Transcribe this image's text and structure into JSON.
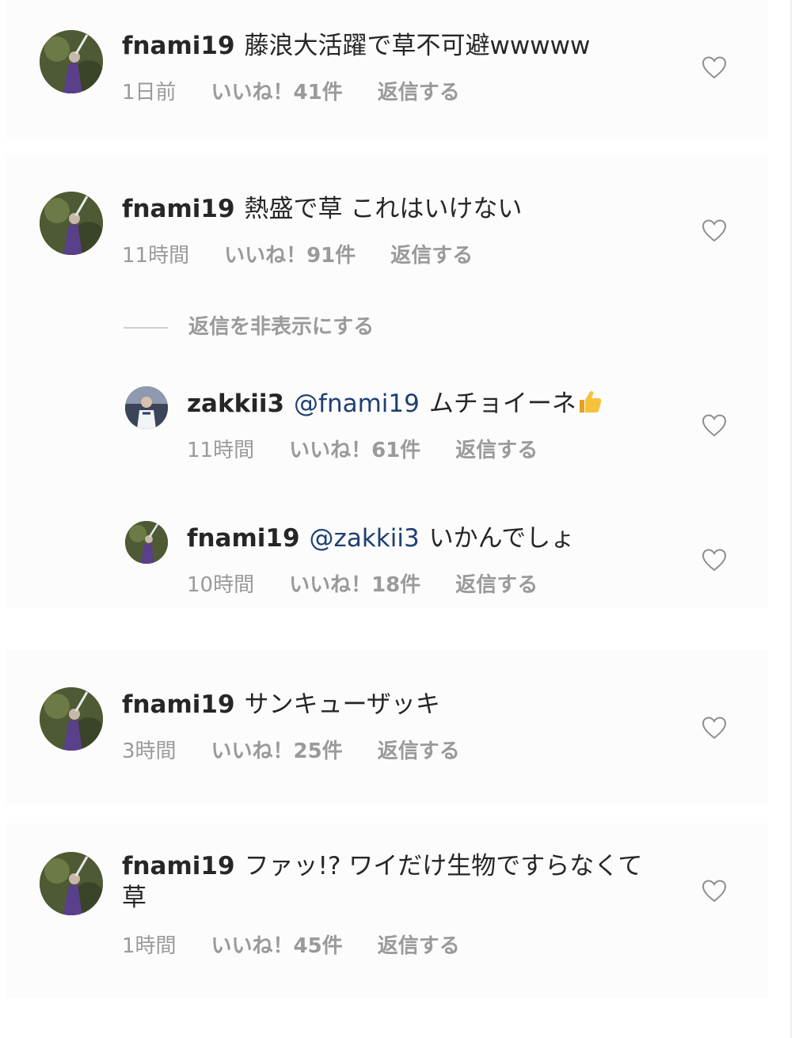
{
  "comments": [
    {
      "username": "fnami19",
      "text": "藤浪大活躍で草不可避wwwww",
      "time": "1日前",
      "likes": "いいね！41件",
      "reply": "返信する"
    },
    {
      "username": "fnami19",
      "text": "熱盛で草  これはいけない",
      "time": "11時間",
      "likes": "いいね！91件",
      "reply": "返信する"
    },
    {
      "username": "fnami19",
      "text": "サンキューザッキ",
      "time": "3時間",
      "likes": "いいね！25件",
      "reply": "返信する"
    },
    {
      "username": "fnami19",
      "text": "ファッ!? ワイだけ生物ですらなくて草",
      "time": "1時間",
      "likes": "いいね！45件",
      "reply": "返信する"
    }
  ],
  "hide_replies": "返信を非表示にする",
  "replies": [
    {
      "username": "zakkii3",
      "mention": "@fnami19",
      "text": "ムチョイーネ",
      "time": "11時間",
      "likes": "いいね！61件",
      "reply": "返信する"
    },
    {
      "username": "fnami19",
      "mention": "@zakkii3",
      "text": "いかんでしょ",
      "time": "10時間",
      "likes": "いいね！18件",
      "reply": "返信する"
    }
  ],
  "colors": {
    "username": "#262626",
    "mention": "#1f3f73",
    "meta": "#9a9a9a"
  },
  "icons": {
    "like": "heart-outline-icon",
    "reaction": "thumbs-up-emoji"
  }
}
